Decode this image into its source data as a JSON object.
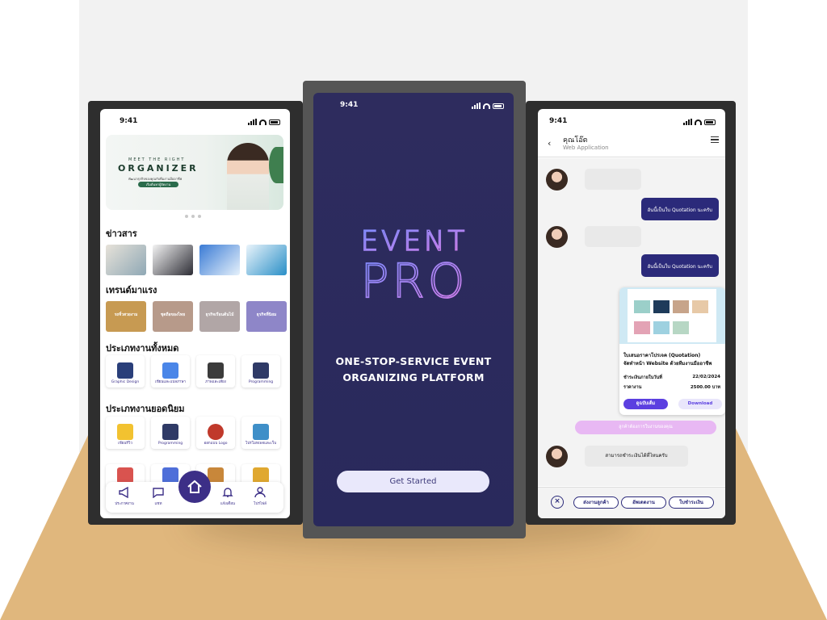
{
  "left_screen": {
    "status_time": "9:41",
    "banner": {
      "small": "MEET THE RIGHT",
      "big": "ORGANIZER",
      "sub": "พัฒนาธุรกิจของคุณกับทีมงานมืออาชีพ",
      "cta": "เริ่มต้นหาผู้จัดงาน"
    },
    "news_title": "ข่าวสาร",
    "trends_title": "เทรนด์มาแรง",
    "trends": [
      "รถจิ๋วสวยงาม",
      "ชุดถือของไทย",
      "ธุรกิจเรือนต้นไม้",
      "ธุรกิจที่นิยม"
    ],
    "all_categories_title": "ประเภทงานทั้งหมด",
    "all_categories": [
      "Graphic Design",
      "เขียนและแปลภาษา",
      "ภาพและเสียง",
      "Programming"
    ],
    "popular_title": "ประเภทงานยอดนิยม",
    "popular": [
      "เขียนรีวิว",
      "Programming",
      "ออกแบบ Logo",
      "โปรโมทเพจและเว็บ"
    ],
    "nav": [
      "ประกาศงาน",
      "แชท",
      "แจ้งเตือน",
      "โปรไฟล์"
    ]
  },
  "middle_screen": {
    "status_time": "9:41",
    "logo_line1": "EVENT",
    "logo_line2": "PRO",
    "tagline_1": "ONE-STOP-SERVICE EVENT",
    "tagline_2": "ORGANIZING PLATFORM",
    "cta": "Get Started"
  },
  "right_screen": {
    "status_time": "9:41",
    "contact_name": "คุณโอ๊ต",
    "contact_role": "Web Application",
    "msg_out_1": "อันนี้เป็นใบ Quotation นะครับ",
    "msg_out_2": "อันนี้เป็นใบ Quotation นะครับ",
    "quote": {
      "title_1": "ใบเสนอราคาโปรเจค (Quotation)",
      "title_2": "จัดทำหน้า Website ด้วยทีมงานมืออาชีพ",
      "due_label": "ชำระเงินภายในวันที่",
      "due_value": "22/02/2024",
      "price_label": "ราคางาน",
      "price_value": "2500.00 บาท",
      "view_btn": "ดูฉบับเต็ม",
      "download_btn": "Download"
    },
    "notice": "ลูกค้าต้องการใบงานของคุณ",
    "msg_in_final": "สามารถชำระเงินได้ที่ไหนครับ",
    "chips": [
      "ส่งงานลูกค้า",
      "อัพเดตงาน",
      "ใบชำระเงิน"
    ]
  },
  "colors": {
    "brand_dark": "#3c2f87",
    "mid_bg": "#2e2c5e",
    "logo_gradient_start": "#7a8cff",
    "logo_gradient_end": "#d77be6",
    "floor": "#e0b77d"
  }
}
